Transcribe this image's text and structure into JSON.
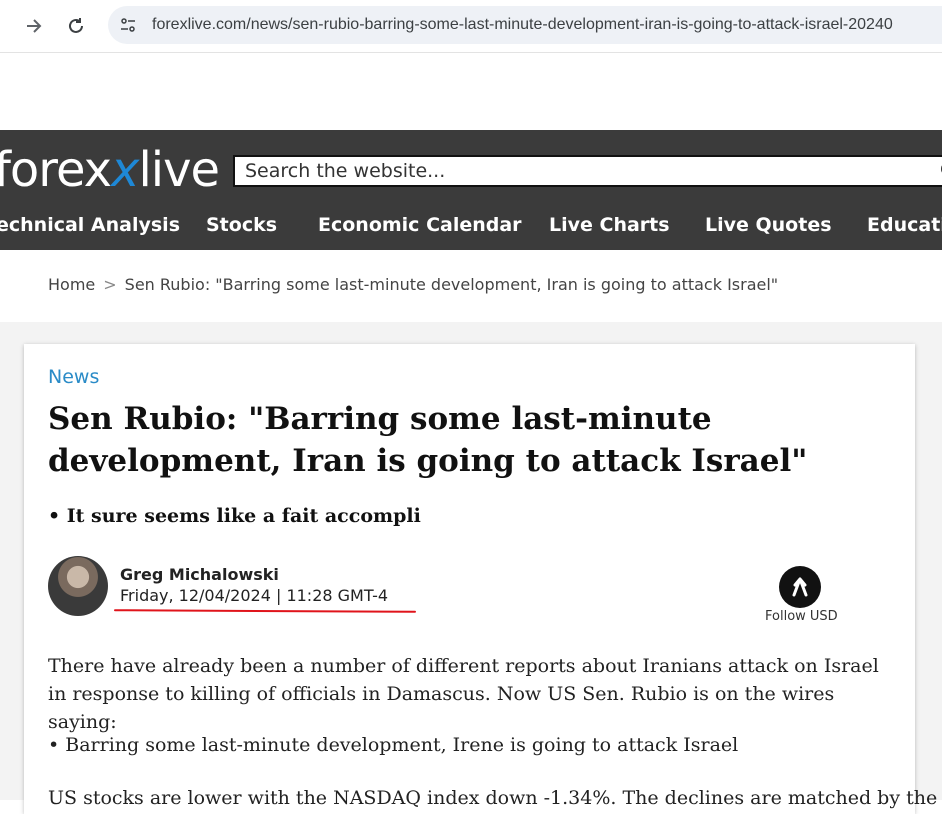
{
  "browser": {
    "url": "forexlive.com/news/sen-rubio-barring-some-last-minute-development-iran-is-going-to-attack-israel-20240"
  },
  "site": {
    "logo_pre": "forex",
    "logo_x": "x",
    "logo_post": "live",
    "search_placeholder": "Search the website...",
    "menu": [
      "echnical Analysis",
      "Stocks",
      "Economic Calendar",
      "Live Charts",
      "Live Quotes",
      "Educatio"
    ]
  },
  "breadcrumb": {
    "home": "Home",
    "separator": ">",
    "current": "Sen Rubio: \"Barring some last-minute development, Iran is going to attack Israel\""
  },
  "article": {
    "category": "News",
    "headline": "Sen Rubio: \"Barring some last-minute development, Iran is going to attack Israel\"",
    "subhead": "• It sure seems like a fait accompli",
    "author": "Greg Michalowski",
    "date": "Friday, 12/04/2024 | 11:28 GMT-4",
    "follow_label": "Follow USD",
    "paragraph1": "There have already been a number of different reports about Iranians attack on Israel in response to killing of officials in Damascus. Now US Sen. Rubio is on the wires saying:",
    "bullet1": "•  Barring some last-minute development, Irene is going to attack Israel",
    "paragraph2": "US stocks are lower with the NASDAQ index down -1.34%. The declines are matched by the"
  }
}
